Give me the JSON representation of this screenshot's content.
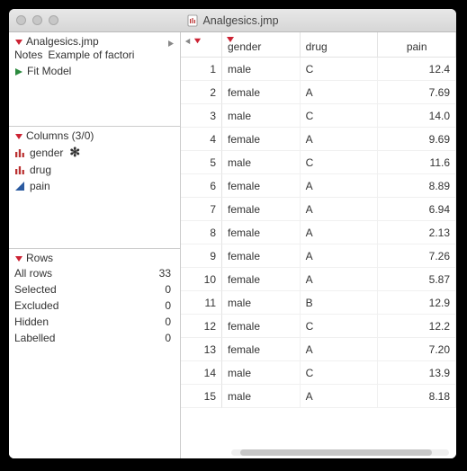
{
  "window": {
    "title": "Analgesics.jmp"
  },
  "info_panel": {
    "title": "Analgesics.jmp",
    "notes_label": "Notes",
    "notes_value": "Example of factori",
    "fit_model": "Fit Model"
  },
  "columns_panel": {
    "title": "Columns (3/0)",
    "items": [
      {
        "name": "gender",
        "type": "nominal",
        "marked": true
      },
      {
        "name": "drug",
        "type": "nominal",
        "marked": false
      },
      {
        "name": "pain",
        "type": "continuous",
        "marked": false
      }
    ]
  },
  "rows_panel": {
    "title": "Rows",
    "stats": [
      {
        "label": "All rows",
        "value": 33
      },
      {
        "label": "Selected",
        "value": 0
      },
      {
        "label": "Excluded",
        "value": 0
      },
      {
        "label": "Hidden",
        "value": 0
      },
      {
        "label": "Labelled",
        "value": 0
      }
    ]
  },
  "table": {
    "columns": [
      "gender",
      "drug",
      "pain"
    ],
    "rows": [
      {
        "n": 1,
        "gender": "male",
        "drug": "C",
        "pain": "12.4"
      },
      {
        "n": 2,
        "gender": "female",
        "drug": "A",
        "pain": "7.69"
      },
      {
        "n": 3,
        "gender": "male",
        "drug": "C",
        "pain": "14.0"
      },
      {
        "n": 4,
        "gender": "female",
        "drug": "A",
        "pain": "9.69"
      },
      {
        "n": 5,
        "gender": "male",
        "drug": "C",
        "pain": "11.6"
      },
      {
        "n": 6,
        "gender": "female",
        "drug": "A",
        "pain": "8.89"
      },
      {
        "n": 7,
        "gender": "female",
        "drug": "A",
        "pain": "6.94"
      },
      {
        "n": 8,
        "gender": "female",
        "drug": "A",
        "pain": "2.13"
      },
      {
        "n": 9,
        "gender": "female",
        "drug": "A",
        "pain": "7.26"
      },
      {
        "n": 10,
        "gender": "female",
        "drug": "A",
        "pain": "5.87"
      },
      {
        "n": 11,
        "gender": "male",
        "drug": "B",
        "pain": "12.9"
      },
      {
        "n": 12,
        "gender": "female",
        "drug": "C",
        "pain": "12.2"
      },
      {
        "n": 13,
        "gender": "female",
        "drug": "A",
        "pain": "7.20"
      },
      {
        "n": 14,
        "gender": "male",
        "drug": "C",
        "pain": "13.9"
      },
      {
        "n": 15,
        "gender": "male",
        "drug": "A",
        "pain": "8.18"
      }
    ]
  }
}
